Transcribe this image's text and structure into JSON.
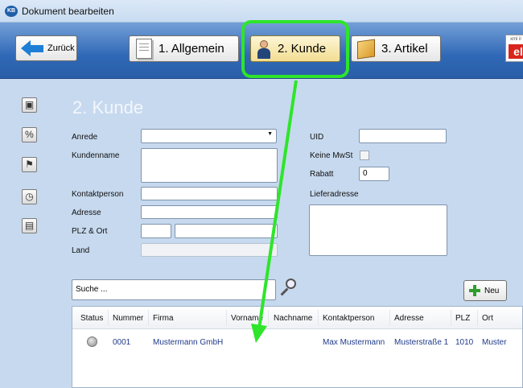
{
  "window": {
    "title": "Dokument bearbeiten",
    "logo_text": "KB"
  },
  "toolbar": {
    "back_label": "Zurück",
    "tabs": [
      {
        "label": "1. Allgemein",
        "icon": "document-icon"
      },
      {
        "label": "2. Kunde",
        "icon": "person-icon",
        "active": true
      },
      {
        "label": "3. Artikel",
        "icon": "package-icon"
      }
    ],
    "brand_small": "xml il",
    "brand_big": "el"
  },
  "section": {
    "title": "2. Kunde"
  },
  "sidebar": {
    "icons": [
      "portrait-icon",
      "percent-icon",
      "signpost-icon",
      "clock-icon",
      "calendar-clock-icon"
    ],
    "percent_glyph": "%"
  },
  "form": {
    "anrede": {
      "label": "Anrede",
      "value": ""
    },
    "kundenname": {
      "label": "Kundenname",
      "value": ""
    },
    "kontaktperson": {
      "label": "Kontaktperson",
      "value": ""
    },
    "adresse": {
      "label": "Adresse",
      "value": ""
    },
    "plz_ort": {
      "label": "PLZ & Ort",
      "plz": "",
      "ort": ""
    },
    "land": {
      "label": "Land",
      "value": ""
    },
    "uid": {
      "label": "UID",
      "value": ""
    },
    "keine_mwst": {
      "label": "Keine MwSt",
      "checked": false
    },
    "rabatt": {
      "label": "Rabatt",
      "value": "0"
    },
    "lieferadresse": {
      "label": "Lieferadresse",
      "value": ""
    }
  },
  "search": {
    "placeholder": "Suche ...",
    "new_label": "Neu"
  },
  "table": {
    "columns": [
      "Status",
      "Nummer",
      "Firma",
      "Vorname",
      "Nachname",
      "Kontaktperson",
      "Adresse",
      "PLZ",
      "Ort"
    ],
    "rows": [
      {
        "status": "inactive",
        "nummer": "0001",
        "firma": "Mustermann GmbH",
        "vorname": "",
        "nachname": "",
        "kontaktperson": "Max Mustermann",
        "adresse": "Musterstraße 1",
        "plz": "1010",
        "ort": "Muster"
      }
    ]
  },
  "colors": {
    "toolbar_blue": "#2f68b6",
    "highlight_green": "#2ee52b",
    "link_text": "#1f3a8a"
  }
}
